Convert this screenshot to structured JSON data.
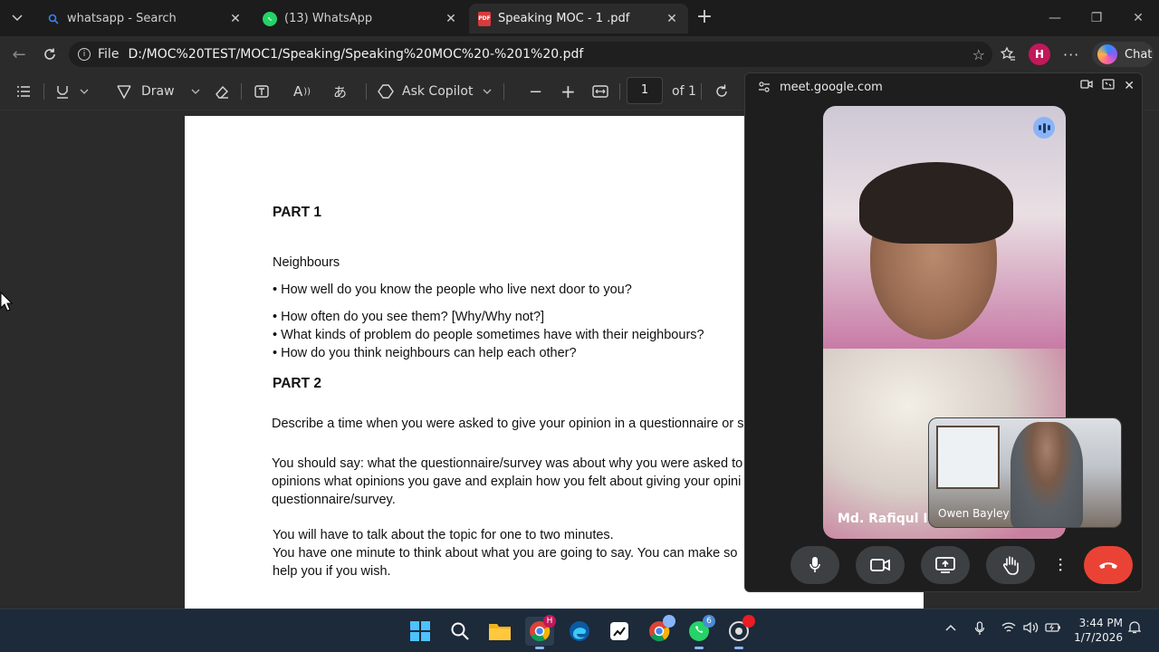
{
  "tabs": [
    {
      "title": "whatsapp - Search",
      "favicon": "search-icon"
    },
    {
      "title": "(13) WhatsApp",
      "favicon": "whatsapp-icon"
    },
    {
      "title": "Speaking MOC - 1 .pdf",
      "favicon": "pdf-icon"
    }
  ],
  "address": {
    "scheme_label": "File",
    "url": "D:/MOC%20TEST/MOC1/Speaking/Speaking%20MOC%20-%201%20.pdf"
  },
  "chat_button": "Chat",
  "pdf_toolbar": {
    "draw_label": "Draw",
    "ask_copilot_label": "Ask Copilot",
    "page_number": "1",
    "page_total": "of 1"
  },
  "document": {
    "part1_heading": "PART 1",
    "topic": "Neighbours",
    "q1": "• How well do you know the people who live next door to you?",
    "q2": "• How often do you see them? [Why/Why not?]",
    "q3": "• What kinds of problem do people sometimes have with their neighbours?",
    "q4": "• How do you think neighbours can help each other?",
    "part2_heading": "PART 2",
    "describe": "Describe a time when you were asked to give your opinion in a questionnaire or s",
    "should_say_1": "You should say: what the questionnaire/survey was about why you were asked to",
    "should_say_2": "opinions what opinions you gave and explain how you felt about giving your opini",
    "should_say_3": "questionnaire/survey.",
    "talk_1": "You will have to talk about the topic for one to two minutes.",
    "talk_2": "You have one minute to think about what you are going to say. You can make so",
    "talk_3": "help you if you wish."
  },
  "meet": {
    "site": "meet.google.com",
    "main_participant": "Md. Rafiqul Is",
    "pip_participant": "Owen Bayley",
    "end_call_color": "#ea4335"
  },
  "taskbar": {
    "whatsapp_badge": "6",
    "time": "3:44 PM",
    "date": "1/7/2026"
  }
}
